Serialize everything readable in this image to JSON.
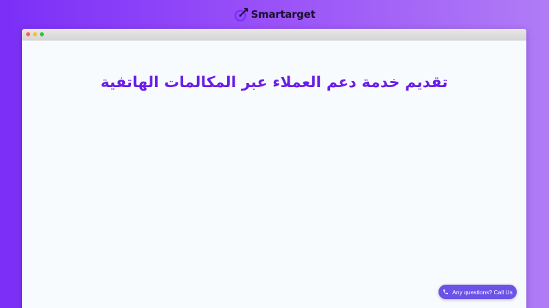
{
  "brand": {
    "name": "Smartarget",
    "logo_icon": "target-arrow-icon",
    "accent_color": "#7b2ff7"
  },
  "browser": {
    "window_controls": [
      "close-dot",
      "minimize-dot",
      "maximize-dot"
    ]
  },
  "main": {
    "headline": "تقديم خدمة دعم العملاء عبر المكالمات الهاتفية",
    "headline_color": "#6a1ee8"
  },
  "cta": {
    "label": "Any questions? Call Us",
    "icon": "phone-icon",
    "color": "#6c52e8"
  }
}
